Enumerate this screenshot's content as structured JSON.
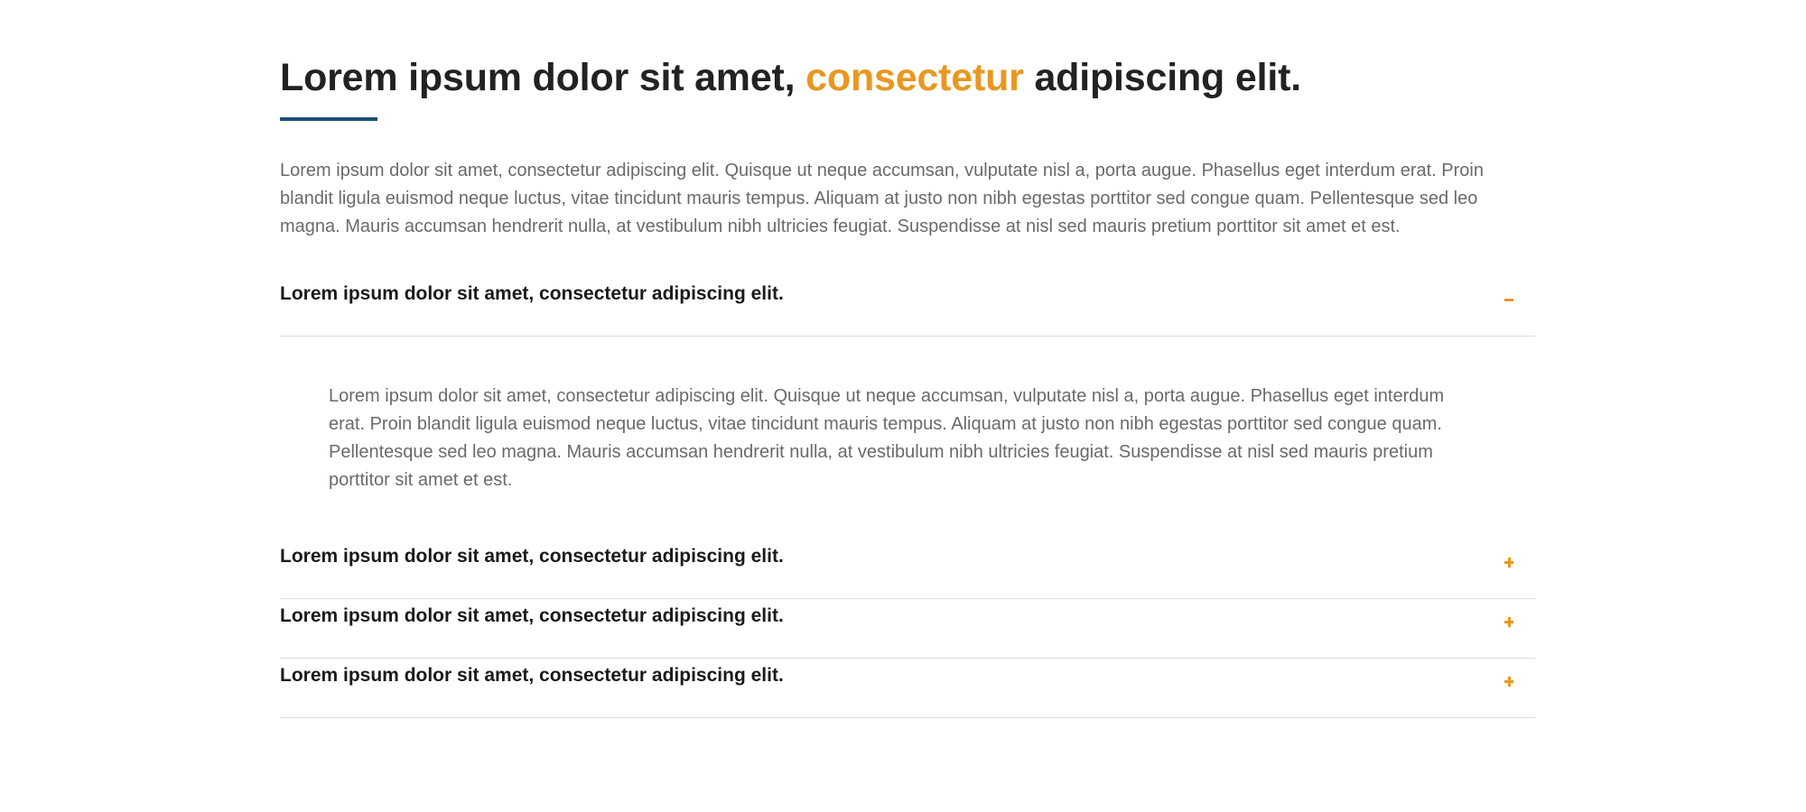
{
  "heading": {
    "before": "Lorem ipsum dolor sit amet, ",
    "accent": "consectetur",
    "after": " adipiscing elit."
  },
  "intro": "Lorem ipsum dolor sit amet, consectetur adipiscing elit. Quisque ut neque accumsan, vulputate nisl a, porta augue. Phasellus eget interdum erat. Proin blandit ligula euismod neque luctus, vitae tincidunt mauris tempus. Aliquam at justo non nibh egestas porttitor sed congue quam. Pellentesque sed leo magna. Mauris accumsan hendrerit nulla, at vestibulum nibh ultricies feugiat. Suspendisse at nisl sed mauris pretium porttitor sit amet et est.",
  "colors": {
    "accent": "#e9971f",
    "underline": "#1f4e79",
    "divider": "#dddddd"
  },
  "accordion": [
    {
      "title": "Lorem ipsum dolor sit amet, consectetur adipiscing elit.",
      "expanded": true,
      "icon": "minus-icon",
      "body": "Lorem ipsum dolor sit amet, consectetur adipiscing elit. Quisque ut neque accumsan, vulputate nisl a, porta augue. Phasellus eget interdum erat. Proin blandit ligula euismod neque luctus, vitae tincidunt mauris tempus. Aliquam at justo non nibh egestas porttitor sed congue quam. Pellentesque sed leo magna. Mauris accumsan hendrerit nulla, at vestibulum nibh ultricies feugiat. Suspendisse at nisl sed mauris pretium porttitor sit amet et est."
    },
    {
      "title": "Lorem ipsum dolor sit amet, consectetur adipiscing elit.",
      "expanded": false,
      "icon": "plus-icon"
    },
    {
      "title": "Lorem ipsum dolor sit amet, consectetur adipiscing elit.",
      "expanded": false,
      "icon": "plus-icon"
    },
    {
      "title": "Lorem ipsum dolor sit amet, consectetur adipiscing elit.",
      "expanded": false,
      "icon": "plus-icon"
    }
  ]
}
